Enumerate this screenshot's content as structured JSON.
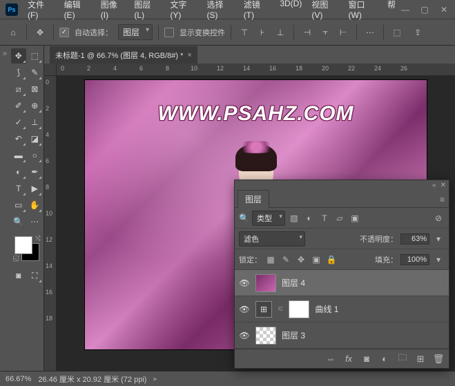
{
  "menu": [
    "文件(F)",
    "编辑(E)",
    "图像(I)",
    "图层(L)",
    "文字(Y)",
    "选择(S)",
    "滤镜(T)",
    "3D(D)",
    "视图(V)",
    "窗口(W)",
    "帮"
  ],
  "optbar": {
    "auto_select": "自动选择：",
    "target": "图层",
    "show_transform": "显示变换控件"
  },
  "tab_title": "未标题-1 @ 66.7% (图层 4, RGB/8#) *",
  "ruler_h": [
    "0",
    "2",
    "4",
    "6",
    "8",
    "10",
    "12",
    "14",
    "16",
    "18",
    "20",
    "22",
    "24",
    "26"
  ],
  "ruler_v": [
    "0",
    "2",
    "4",
    "6",
    "8",
    "10",
    "12",
    "14",
    "16",
    "18"
  ],
  "watermark": "WWW.PSAHZ.COM",
  "status": {
    "zoom": "66.67%",
    "dims": "26.46 厘米 x 20.92 厘米 (72 ppi)"
  },
  "layers": {
    "title": "图层",
    "type_label": "类型",
    "blend": "滤色",
    "opacity_label": "不透明度：",
    "opacity": "63%",
    "lock_label": "锁定：",
    "fill_label": "填充：",
    "fill": "100%",
    "items": [
      {
        "name": "图层 4",
        "kind": "img",
        "sel": true
      },
      {
        "name": "曲线 1",
        "kind": "adj"
      },
      {
        "name": "图层 3",
        "kind": "trans"
      }
    ]
  }
}
